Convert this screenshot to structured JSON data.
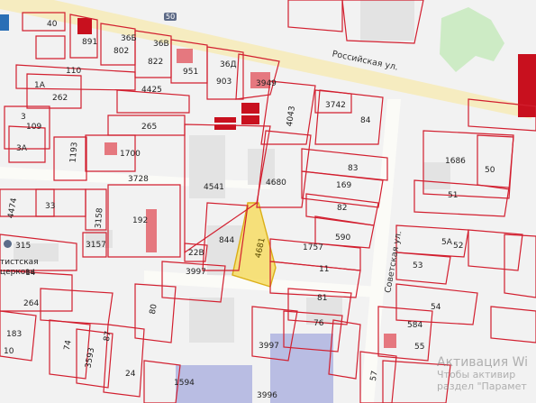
{
  "map": {
    "streets": {
      "rossiyskaya": "Российская ул.",
      "sovetskaya": "Советская ул."
    },
    "church_label_line1": "тистская",
    "church_label_line2": "церковь",
    "highlighted_parcel": "4681",
    "road_badge": "50",
    "parcels": [
      "40",
      "891",
      "802",
      "36Б",
      "36В",
      "822",
      "951",
      "36Д",
      "903",
      "3949",
      "110",
      "1А",
      "262",
      "4425",
      "3",
      "109",
      "3А",
      "1193",
      "1700",
      "265",
      "3742",
      "84",
      "4043",
      "3728",
      "4541",
      "4680",
      "83",
      "169",
      "1686",
      "50",
      "4474",
      "33",
      "3158",
      "192",
      "844",
      "82",
      "51",
      "315",
      "3157",
      "22В",
      "1757",
      "590",
      "5А",
      "52",
      "14",
      "3997",
      "11",
      "53",
      "264",
      "80",
      "81",
      "54",
      "183",
      "74",
      "3593",
      "87",
      "76",
      "584",
      "10",
      "3997",
      "55",
      "24",
      "1594",
      "3996",
      "57"
    ],
    "watermark": {
      "line1": "Активация Wi",
      "line2": "Чтобы активир",
      "line3": "раздел \"Парамет"
    }
  },
  "colors": {
    "parcel_border": "#d21f2f",
    "highlight": "#f7df6e",
    "main_road": "#f6ecc0",
    "green_area": "#cdebc5"
  }
}
